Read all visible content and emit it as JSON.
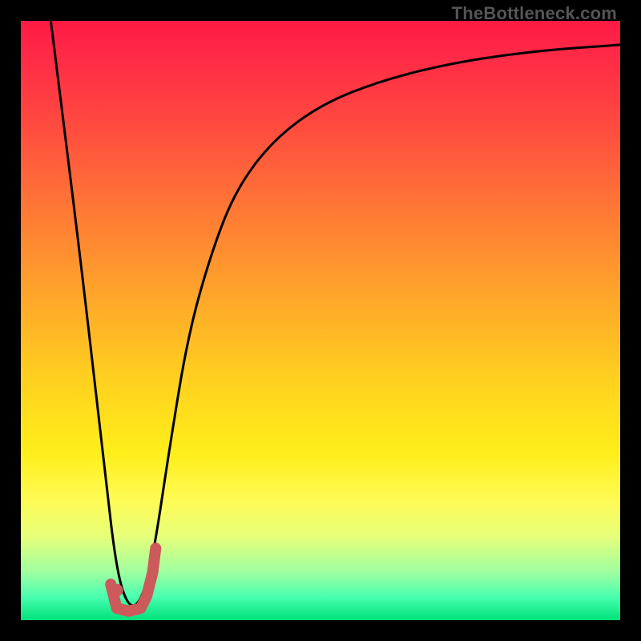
{
  "watermark": "TheBottleneck.com",
  "chart_data": {
    "type": "line",
    "title": "",
    "xlabel": "",
    "ylabel": "",
    "xlim": [
      0,
      100
    ],
    "ylim": [
      0,
      100
    ],
    "note": "Axes are unlabeled; values are estimated in percent-of-plot coordinates (y increases upward).",
    "series": [
      {
        "name": "bottleneck-curve",
        "color": "#000000",
        "x": [
          5,
          10,
          14,
          16,
          18,
          20,
          22,
          25,
          28,
          32,
          36,
          42,
          50,
          60,
          72,
          86,
          100
        ],
        "y": [
          100,
          60,
          25,
          8,
          2,
          3,
          10,
          30,
          48,
          62,
          72,
          80,
          86,
          90,
          93,
          95,
          96
        ]
      }
    ],
    "marker": {
      "name": "optimal-point",
      "color": "#cc5a5a",
      "cx": 16,
      "cy": 5
    },
    "hook_path": {
      "name": "optimal-hook",
      "color": "#cc5a5a",
      "x": [
        15,
        16,
        18,
        20,
        21,
        22,
        22.5
      ],
      "y": [
        6,
        2,
        1.5,
        2,
        4,
        8,
        12
      ]
    }
  }
}
